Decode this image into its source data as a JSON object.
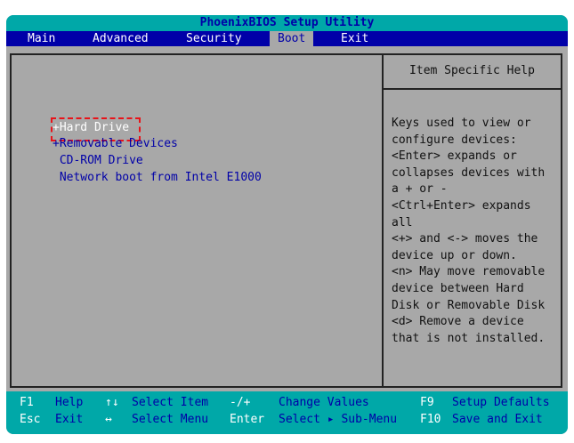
{
  "title": "PhoenixBIOS Setup Utility",
  "tabs": [
    {
      "label": "Main",
      "selected": false
    },
    {
      "label": "Advanced",
      "selected": false
    },
    {
      "label": "Security",
      "selected": false
    },
    {
      "label": "Boot",
      "selected": true
    },
    {
      "label": "Exit",
      "selected": false
    }
  ],
  "boot_items": [
    "+Hard Drive",
    "+Removable Devices",
    " CD-ROM Drive",
    " Network boot from Intel E1000"
  ],
  "help": {
    "title": "Item Specific Help",
    "lines": [
      "Keys used to view or",
      "configure devices:",
      "<Enter> expands or",
      "collapses devices with",
      "a + or -",
      "<Ctrl+Enter> expands",
      "all",
      "<+> and <-> moves the",
      "device up or down.",
      "<n> May move removable",
      "device between Hard",
      "Disk or Removable Disk",
      "<d> Remove a device",
      "that is not installed."
    ]
  },
  "footer": [
    [
      {
        "key": "F1",
        "desc": "Help"
      },
      {
        "key": "↑↓",
        "desc": "Select Item"
      },
      {
        "key": "-/+",
        "desc": "Change Values"
      },
      {
        "key": "F9",
        "desc": "Setup Defaults"
      }
    ],
    [
      {
        "key": "Esc",
        "desc": "Exit"
      },
      {
        "key": "↔",
        "desc": "Select Menu"
      },
      {
        "key": "Enter",
        "desc": "Select ▸ Sub-Menu"
      },
      {
        "key": "F10",
        "desc": "Save and Exit"
      }
    ]
  ],
  "colors": {
    "teal": "#00a8a8",
    "blue": "#0000a8",
    "gray": "#a8a8a8",
    "highlight": "#e8141a"
  }
}
